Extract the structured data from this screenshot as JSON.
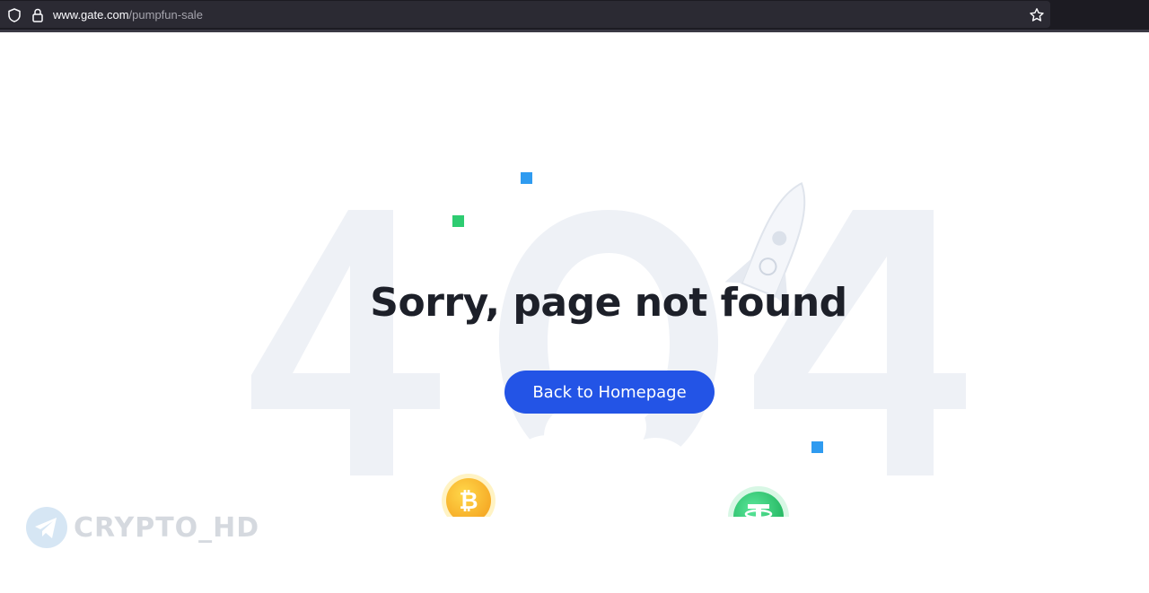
{
  "browser": {
    "url_host": "www.gate.com",
    "url_path": "/pumpfun-sale",
    "icons": [
      "shield-icon",
      "lock-icon",
      "star-bookmark-icon"
    ]
  },
  "page": {
    "error_code": "404",
    "title": "Sorry, page not found",
    "button_label": "Back to Homepage",
    "colors": {
      "button": "#2354e6",
      "title": "#1d2029",
      "background_404": "#eef1f6",
      "accent_blue": "#2f9bf0",
      "accent_green": "#2ecc71"
    },
    "coins": [
      "bitcoin-coin-icon",
      "tether-coin-icon"
    ]
  },
  "watermark": {
    "text": "CRYPTO_HD",
    "icon": "telegram-icon"
  }
}
